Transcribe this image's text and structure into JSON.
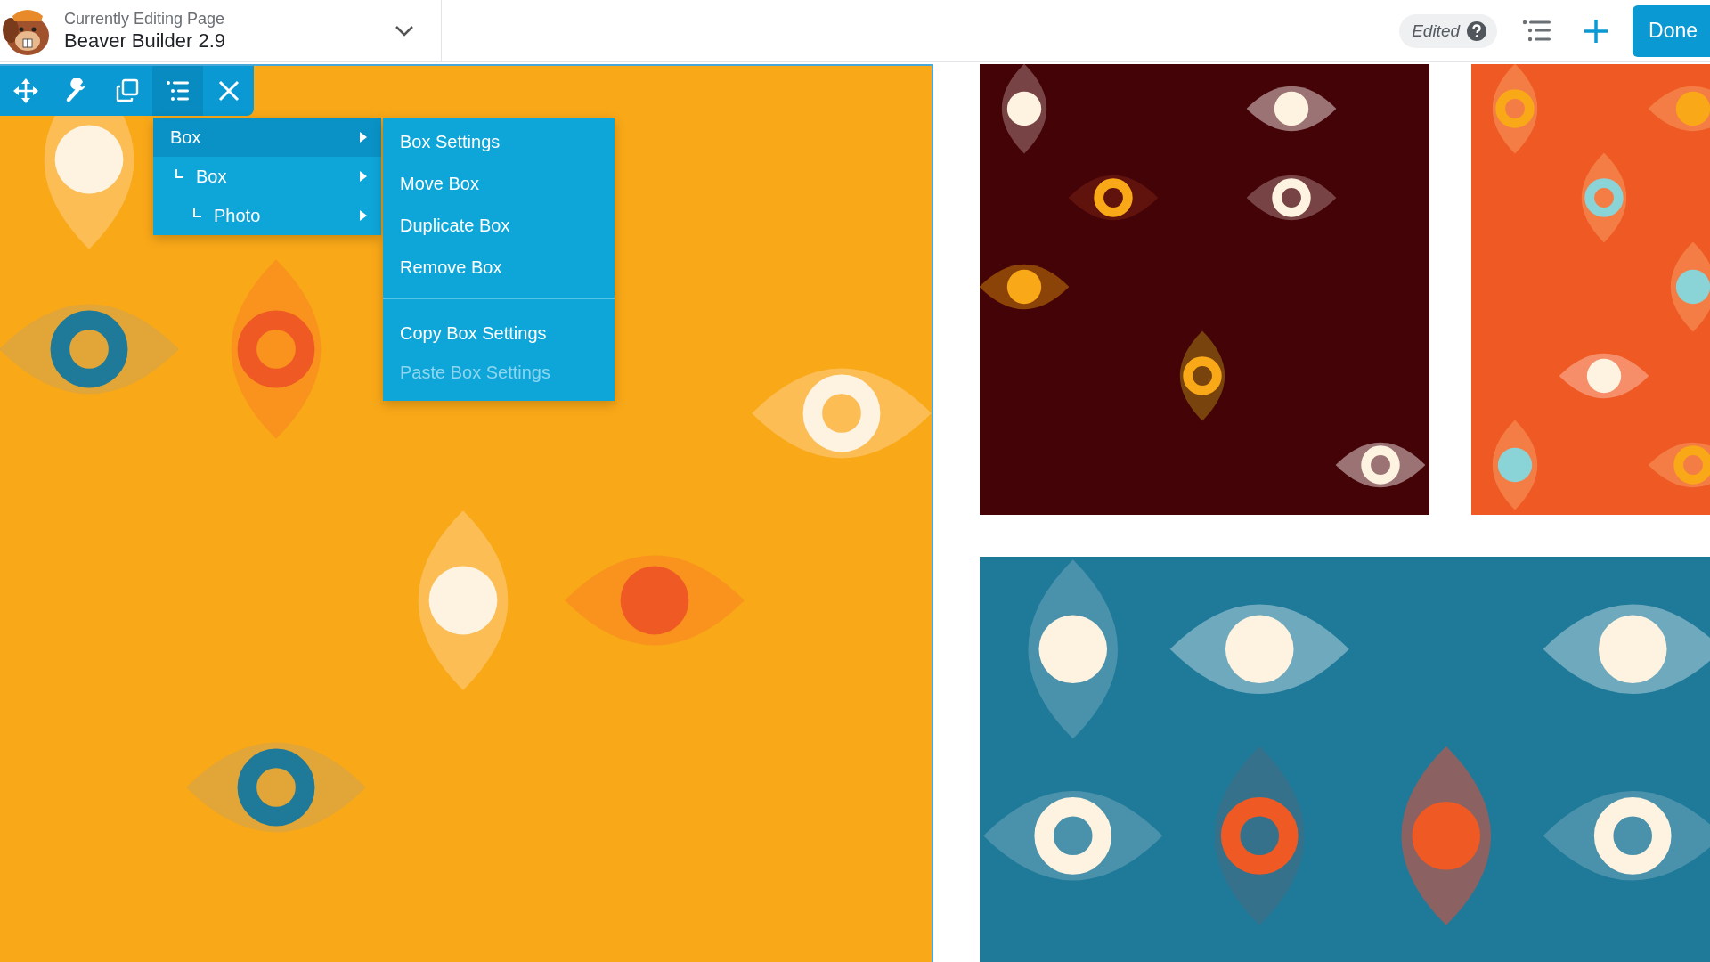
{
  "header": {
    "subtitle": "Currently Editing Page",
    "title": "Beaver Builder 2.9"
  },
  "status": {
    "label": "Edited"
  },
  "done_button": {
    "label": "Done"
  },
  "toolbar": {
    "items": [
      {
        "kind": "move",
        "selected": false
      },
      {
        "kind": "settings",
        "selected": false
      },
      {
        "kind": "duplicate",
        "selected": false
      },
      {
        "kind": "outline",
        "selected": true
      },
      {
        "kind": "close",
        "selected": false
      }
    ]
  },
  "context_menu": {
    "items": [
      {
        "label": "Box",
        "selected": true,
        "children": [
          {
            "label": "Box",
            "selected": false,
            "children": [
              {
                "label": "Photo",
                "selected": false
              }
            ]
          }
        ]
      }
    ],
    "actions": [
      {
        "items": [
          {
            "label": "Box Settings",
            "disabled": false
          },
          {
            "label": "Move Box",
            "disabled": false
          },
          {
            "label": "Duplicate Box",
            "disabled": false
          },
          {
            "label": "Remove Box",
            "disabled": false
          }
        ]
      },
      {
        "items": [
          {
            "label": "Copy Box Settings",
            "disabled": false
          },
          {
            "label": "Paste Box Settings",
            "disabled": true
          }
        ]
      }
    ]
  }
}
